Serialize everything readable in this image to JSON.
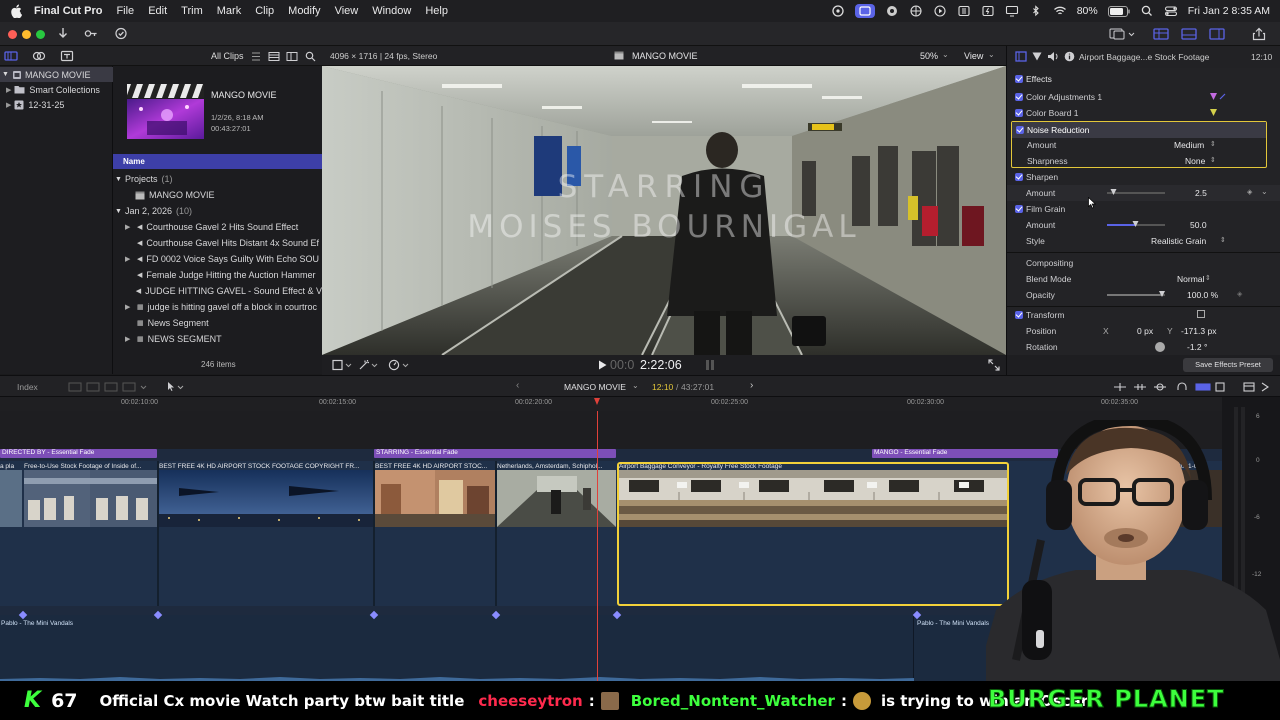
{
  "menubar": {
    "app": "Final Cut Pro",
    "items": [
      "File",
      "Edit",
      "Trim",
      "Mark",
      "Clip",
      "Modify",
      "View",
      "Window",
      "Help"
    ],
    "battery": "80%",
    "clock": "Fri Jan 2  8:35 AM"
  },
  "browser": {
    "filter": "All Clips",
    "library_name": "MANGO MOVIE",
    "smart_collections": "Smart Collections",
    "event_folder": "12-31-25",
    "project_title": "MANGO MOVIE",
    "project_date": "1/2/26, 8:18 AM",
    "project_duration": "00:43:27:01",
    "col_name": "Name",
    "projects_group": "Projects",
    "projects_count": "(1)",
    "project_item": "MANGO MOVIE",
    "date_group": "Jan 2, 2026",
    "date_count": "(10)",
    "clips": [
      "Courthouse Gavel 2 Hits Sound Effect",
      "Courthouse Gavel Hits Distant 4x Sound Ef",
      "FD 0002  Voice Says Guilty With Echo SOU",
      "Female Judge Hitting the Auction Hammer",
      "JUDGE HITTING GAVEL - Sound Effect & V",
      "judge is hitting gavel off a block in courtroc",
      "News Segment",
      "NEWS SEGMENT"
    ],
    "item_count": "246 items"
  },
  "viewer": {
    "format": "4096 × 1716 | 24 fps, Stereo",
    "title": "MANGO MOVIE",
    "zoom": "50%",
    "view_menu": "View",
    "overlay_line1": "STARRING",
    "overlay_line2": "MOISES BOURNIGAL",
    "timecode_dim": "00:0",
    "timecode": "2:22:06"
  },
  "inspector": {
    "clip_title": "Airport Baggage...e Stock Footage",
    "clip_time": "12:10",
    "effects_header": "Effects",
    "color_adjustments": "Color Adjustments 1",
    "color_board": "Color Board 1",
    "noise_reduction": "Noise Reduction",
    "nr_amount_label": "Amount",
    "nr_amount_value": "Medium",
    "nr_sharpness_label": "Sharpness",
    "nr_sharpness_value": "None",
    "sharpen": "Sharpen",
    "sharpen_amount_label": "Amount",
    "sharpen_amount_value": "2.5",
    "sharpen_amount_level": 0.12,
    "film_grain": "Film Grain",
    "fg_amount_label": "Amount",
    "fg_amount_value": "50.0",
    "fg_amount_level": 0.5,
    "fg_style_label": "Style",
    "fg_style_value": "Realistic Grain",
    "compositing": "Compositing",
    "blend_label": "Blend Mode",
    "blend_value": "Normal",
    "opacity_label": "Opacity",
    "opacity_value": "100.0 %",
    "transform": "Transform",
    "position_label": "Position",
    "pos_x_label": "X",
    "pos_x_value": "0 px",
    "pos_y_label": "Y",
    "pos_y_value": "-171.3 px",
    "rotation_label": "Rotation",
    "rotation_value": "-1.2 °",
    "save_preset": "Save Effects Preset"
  },
  "timeline": {
    "index": "Index",
    "project": "MANGO MOVIE",
    "position": "12:10",
    "duration": "43:27:01",
    "ruler": [
      "00:02:10:00",
      "00:02:15:00",
      "00:02:20:00",
      "00:02:25:00",
      "00:02:30:00",
      "00:02:35:00"
    ],
    "titles": [
      "DIRECTED BY - Essential Fade",
      "STARRING - Essential Fade",
      "MANGO - Essential Fade"
    ],
    "clips": [
      "a pla",
      "Free-to-Use Stock Footage of Inside of...",
      "BEST FREE 4K  HD AIRPORT STOCK FOOTAGE  COPYRIGHT FR...",
      "BEST FREE 4K  HD AIRPORT STOC...",
      "Netherlands, Amsterdam, Schiphol...",
      "Airport Baggage Conveyor - Royalty Free Stock Footage",
      "MVI_0001-011"
    ],
    "audio": [
      "Pablo - The Mini Vandals",
      "Pablo - The Mini Vandals"
    ],
    "meter": [
      "6",
      "0",
      "-6",
      "-12"
    ]
  },
  "banner": {
    "k_count": "67",
    "message": "Official Cx movie Watch party btw bait title",
    "user1": "cheeseytron",
    "user2": "Bored_Nontent_Watcher",
    "message2": "is trying to win an Oscar",
    "sponsor": "BURGER PLANET"
  },
  "colors": {
    "accent": "#5a63e6",
    "title_clip": "#7d4fb8",
    "selection": "#f2d13a",
    "playhead": "#e0413a",
    "banner_user1": "#ff2a4d",
    "banner_user2": "#3dff3d"
  }
}
